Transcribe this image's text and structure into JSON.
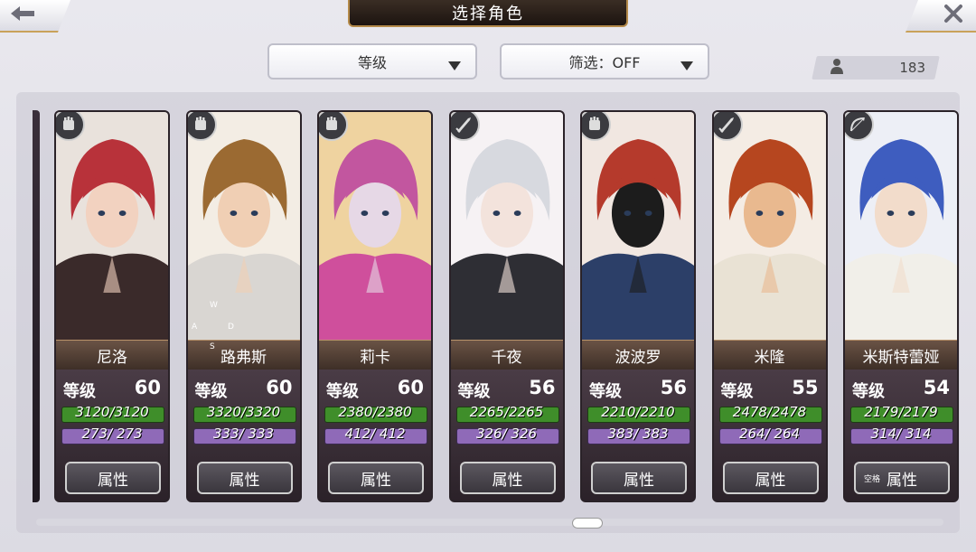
{
  "header": {
    "title": "选择角色",
    "back_icon": "back-arrow-icon",
    "close_icon": "close-icon"
  },
  "filters": {
    "sort_label": "等级",
    "filter_label": "筛选：OFF"
  },
  "roster": {
    "count": "183",
    "icon": "user-icon"
  },
  "characters": [
    {
      "name": "尼洛",
      "level_label": "等级",
      "level": "60",
      "hp": "3120/3120",
      "mp": "273/ 273",
      "button": "属性",
      "class_icon": "gauntlet-icon",
      "hair": "#b8323a",
      "skin": "#f2d2c0",
      "bg": "#e9e2dc",
      "cloth": "#3a2a2a"
    },
    {
      "name": "路弗斯",
      "level_label": "等级",
      "level": "60",
      "hp": "3320/3320",
      "mp": "333/ 333",
      "button": "属性",
      "class_icon": "gauntlet-icon",
      "hair": "#9b6a32",
      "skin": "#f0cfb4",
      "bg": "#f3ede4",
      "cloth": "#d9d6d2"
    },
    {
      "name": "莉卡",
      "level_label": "等级",
      "level": "60",
      "hp": "2380/2380",
      "mp": "412/ 412",
      "button": "属性",
      "class_icon": "gauntlet-icon",
      "hair": "#c2569f",
      "skin": "#e6d8e6",
      "bg": "#efd3a0",
      "cloth": "#cf4f9c"
    },
    {
      "name": "千夜",
      "level_label": "等级",
      "level": "56",
      "hp": "2265/2265",
      "mp": "326/ 326",
      "button": "属性",
      "class_icon": "sword-icon",
      "hair": "#d7d9df",
      "skin": "#f3e3dc",
      "bg": "#f6f2f4",
      "cloth": "#2e2e34"
    },
    {
      "name": "波波罗",
      "level_label": "等级",
      "level": "56",
      "hp": "2210/2210",
      "mp": "383/ 383",
      "button": "属性",
      "class_icon": "gauntlet-icon",
      "hair": "#b53a2c",
      "skin": "#1c1c1c",
      "bg": "#f1e7e1",
      "cloth": "#2c3f68"
    },
    {
      "name": "米隆",
      "level_label": "等级",
      "level": "55",
      "hp": "2478/2478",
      "mp": "264/ 264",
      "button": "属性",
      "class_icon": "sword-icon",
      "hair": "#b6461f",
      "skin": "#e9b98f",
      "bg": "#f4ece4",
      "cloth": "#e9e2d4"
    },
    {
      "name": "米斯特蕾娅",
      "level_label": "等级",
      "level": "54",
      "hp": "2179/2179",
      "mp": "314/ 314",
      "button": "属性",
      "class_icon": "bow-icon",
      "hair": "#3e5dbf",
      "skin": "#f2dccb",
      "bg": "#edeff6",
      "cloth": "#f1efe9"
    }
  ],
  "overlay": {
    "wasd_w": "W",
    "wasd_a": "A",
    "wasd_d": "D",
    "wasd_s": "S",
    "space_key": "空格"
  }
}
